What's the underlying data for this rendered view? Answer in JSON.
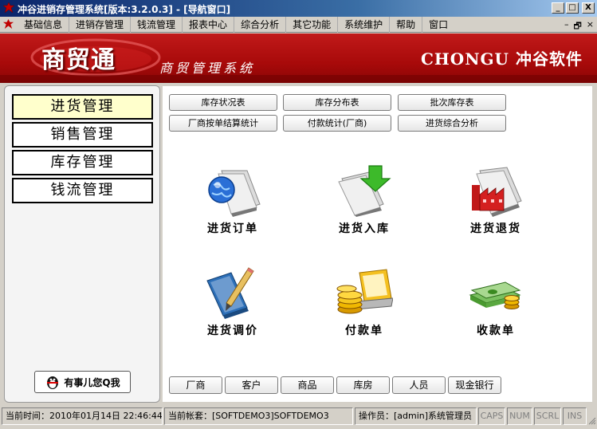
{
  "window": {
    "title": "冲谷进销存管理系统[版本:3.2.0.3] - [导航窗口]",
    "buttons": [
      "_",
      "□",
      "X"
    ]
  },
  "menu": {
    "items": [
      "基础信息",
      "进销存管理",
      "钱流管理",
      "报表中心",
      "综合分析",
      "其它功能",
      "系统维护",
      "帮助",
      "窗口"
    ],
    "mdi_controls": [
      "–",
      "🗗",
      "×"
    ]
  },
  "banner": {
    "logo": "商贸通",
    "subtitle": "商贸管理系统",
    "brand_en": "CHONGU",
    "brand_cn": "冲谷软件"
  },
  "left_nav": {
    "items": [
      "进货管理",
      "销售管理",
      "库存管理",
      "钱流管理"
    ],
    "active": "进货管理",
    "qq_button": "有事儿您Q我"
  },
  "quick_buttons": [
    "库存状况表",
    "库存分布表",
    "批次库存表",
    "厂商按单结算统计",
    "付款统计(厂商)",
    "进货综合分析"
  ],
  "function_icons": [
    {
      "label": "进货订单",
      "icon": "globe-document-icon"
    },
    {
      "label": "进货入库",
      "icon": "download-arrow-document-icon"
    },
    {
      "label": "进货退货",
      "icon": "factory-document-icon"
    },
    {
      "label": "进货调价",
      "icon": "pencil-book-icon"
    },
    {
      "label": "付款单",
      "icon": "coins-laptop-icon"
    },
    {
      "label": "收款单",
      "icon": "money-stack-icon"
    }
  ],
  "bottom_buttons": [
    "厂商",
    "客户",
    "商品",
    "库房",
    "人员",
    "现金银行"
  ],
  "status": {
    "time": "当前时间：2010年01月14日 22:46:44",
    "account": "当前帐套：[SOFTDEMO3]SOFTDEMO3",
    "operator": "操作员：[admin]系统管理员",
    "indicators": [
      "CAPS",
      "NUM",
      "SCRL",
      "INS"
    ]
  },
  "colors": {
    "banner_red": "#a80a0a",
    "title_blue": "#0a246a",
    "active_nav": "#ffffcc"
  }
}
